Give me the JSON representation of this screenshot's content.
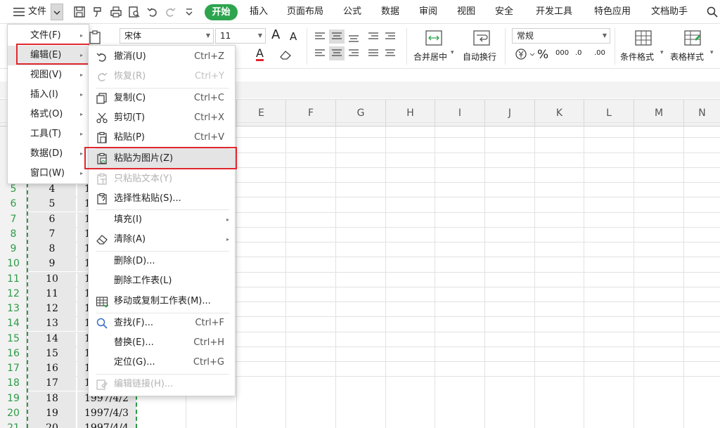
{
  "menubar": {
    "file_label": "文件",
    "tabs": [
      "开始",
      "插入",
      "页面布局",
      "公式",
      "数据",
      "审阅",
      "视图",
      "安全",
      "开发工具",
      "特色应用",
      "文档助手"
    ],
    "active_tab": "开始",
    "accent_color": "#2da44e"
  },
  "ribbon": {
    "font_name": "宋体",
    "font_size": "11",
    "number_format": "常规",
    "merge_label": "合并居中",
    "wrap_label": "自动换行",
    "cond_format_label": "条件格式",
    "table_style_label": "表格样式",
    "big_a": "A",
    "small_a": "A",
    "percent": "%",
    "thousands": "000",
    "dec_inc": ".0",
    "dec_dec": ".00"
  },
  "columns": [
    "E",
    "F",
    "G",
    "H",
    "I",
    "J",
    "K",
    "L",
    "M",
    "N"
  ],
  "rows": [
    {
      "num": "5",
      "a": "4",
      "b": "1"
    },
    {
      "num": "6",
      "a": "5",
      "b": "1"
    },
    {
      "num": "7",
      "a": "6",
      "b": "1"
    },
    {
      "num": "8",
      "a": "7",
      "b": "1"
    },
    {
      "num": "9",
      "a": "8",
      "b": "1"
    },
    {
      "num": "10",
      "a": "9",
      "b": "1"
    },
    {
      "num": "11",
      "a": "10",
      "b": "1"
    },
    {
      "num": "12",
      "a": "11",
      "b": "1"
    },
    {
      "num": "13",
      "a": "12",
      "b": "1"
    },
    {
      "num": "14",
      "a": "13",
      "b": "1"
    },
    {
      "num": "15",
      "a": "14",
      "b": "1"
    },
    {
      "num": "16",
      "a": "15",
      "b": "1"
    },
    {
      "num": "17",
      "a": "16",
      "b": "1"
    },
    {
      "num": "18",
      "a": "17",
      "b": "1"
    },
    {
      "num": "19",
      "a": "18",
      "b": "1997/4/2"
    },
    {
      "num": "20",
      "a": "19",
      "b": "1997/4/3"
    },
    {
      "num": "21",
      "a": "20",
      "b": "1997/4/4"
    }
  ],
  "file_menu": {
    "items": [
      {
        "label": "文件(F)",
        "arrow": "▸"
      },
      {
        "label": "编辑(E)",
        "arrow": "▸"
      },
      {
        "label": "视图(V)",
        "arrow": "▸"
      },
      {
        "label": "插入(I)",
        "arrow": "▸"
      },
      {
        "label": "格式(O)",
        "arrow": "▸"
      },
      {
        "label": "工具(T)",
        "arrow": "▸"
      },
      {
        "label": "数据(D)",
        "arrow": "▸"
      },
      {
        "label": "窗口(W)",
        "arrow": "▸"
      }
    ],
    "selected": "编辑(E)"
  },
  "edit_menu": {
    "items": [
      {
        "label": "撤消(U)",
        "shortcut": "Ctrl+Z",
        "icon": "undo-icon",
        "enabled": true
      },
      {
        "label": "恢复(R)",
        "shortcut": "Ctrl+Y",
        "icon": "redo-icon",
        "enabled": false
      },
      {
        "label": "复制(C)",
        "shortcut": "Ctrl+C",
        "icon": "copy-icon",
        "enabled": true
      },
      {
        "label": "剪切(T)",
        "shortcut": "Ctrl+X",
        "icon": "cut-icon",
        "enabled": true
      },
      {
        "label": "粘贴(P)",
        "shortcut": "Ctrl+V",
        "icon": "paste-icon",
        "enabled": true
      },
      {
        "label": "粘贴为图片(Z)",
        "shortcut": "",
        "icon": "paste-as-picture-icon",
        "enabled": true,
        "highlighted": true
      },
      {
        "label": "只粘贴文本(Y)",
        "shortcut": "",
        "icon": "paste-text-only-icon",
        "enabled": false
      },
      {
        "label": "选择性粘贴(S)...",
        "shortcut": "",
        "icon": "paste-special-icon",
        "enabled": true
      },
      {
        "label": "填充(I)",
        "shortcut": "",
        "icon": "",
        "enabled": true,
        "submenu": "▸"
      },
      {
        "label": "清除(A)",
        "shortcut": "",
        "icon": "eraser-icon",
        "enabled": true,
        "submenu": "▸"
      },
      {
        "label": "删除(D)...",
        "shortcut": "",
        "icon": "",
        "enabled": true
      },
      {
        "label": "删除工作表(L)",
        "shortcut": "",
        "icon": "",
        "enabled": true
      },
      {
        "label": "移动或复制工作表(M)...",
        "shortcut": "",
        "icon": "move-copy-sheet-icon",
        "enabled": true
      },
      {
        "label": "查找(F)...",
        "shortcut": "Ctrl+F",
        "icon": "search-icon",
        "enabled": true
      },
      {
        "label": "替换(E)...",
        "shortcut": "Ctrl+H",
        "icon": "",
        "enabled": true
      },
      {
        "label": "定位(G)...",
        "shortcut": "Ctrl+G",
        "icon": "",
        "enabled": true
      },
      {
        "label": "编辑链接(H)...",
        "shortcut": "",
        "icon": "edit-links-icon",
        "enabled": false
      }
    ]
  },
  "colors": {
    "highlight_border": "#e0272f",
    "row_header_text": "#2e9a47"
  }
}
